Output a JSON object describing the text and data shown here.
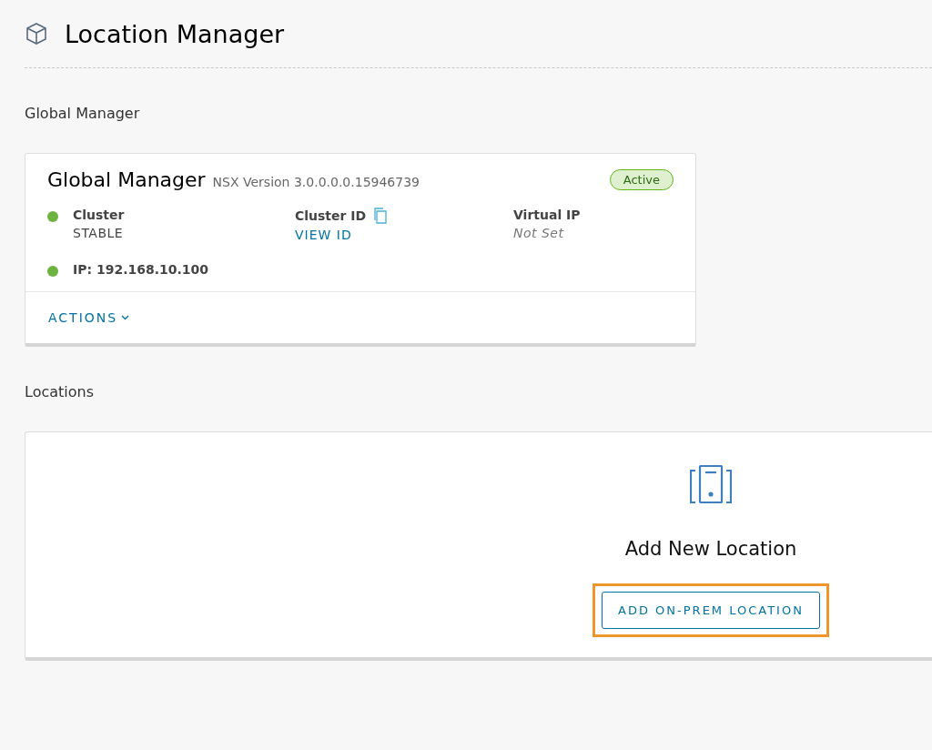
{
  "page": {
    "title": "Location Manager"
  },
  "global_manager": {
    "section_title": "Global Manager",
    "card": {
      "title": "Global Manager",
      "version": "NSX Version 3.0.0.0.0.15946739",
      "status_badge": "Active",
      "cluster": {
        "label": "Cluster",
        "value": "STABLE",
        "color": "#6db33f"
      },
      "cluster_id": {
        "label": "Cluster ID",
        "link": "VIEW ID"
      },
      "virtual_ip": {
        "label": "Virtual IP",
        "value": "Not Set"
      },
      "ip": {
        "label": "IP: 192.168.10.100",
        "color": "#6db33f"
      },
      "actions": "ACTIONS"
    }
  },
  "locations": {
    "section_title": "Locations",
    "empty_title": "Add New Location",
    "button": {
      "label": "ADD ON-PREM LOCATION",
      "highlighted": true
    }
  }
}
